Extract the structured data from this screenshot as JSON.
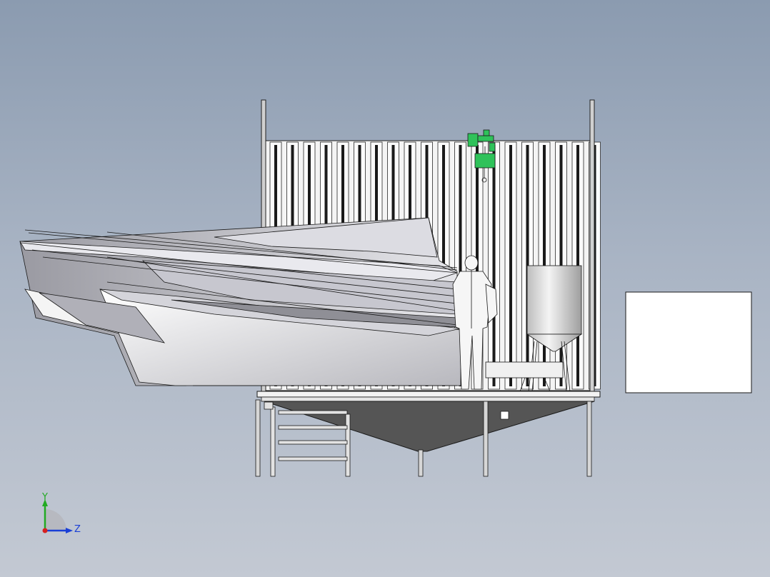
{
  "viewport": {
    "background_top": "#8b9bb0",
    "background_bottom": "#c3c9d3"
  },
  "model": {
    "hoist_color": "#2fc25a",
    "hopper_fill": "#d8d8d8",
    "platform_fill": "#f2f2f2",
    "funnel_fill": "#555555",
    "outline_color": "#1a1a1a"
  },
  "triad": {
    "y_label": "Y",
    "z_label": "Z",
    "y_color": "#22aa22",
    "z_color": "#1a3fd6",
    "x_color": "#d62020"
  }
}
